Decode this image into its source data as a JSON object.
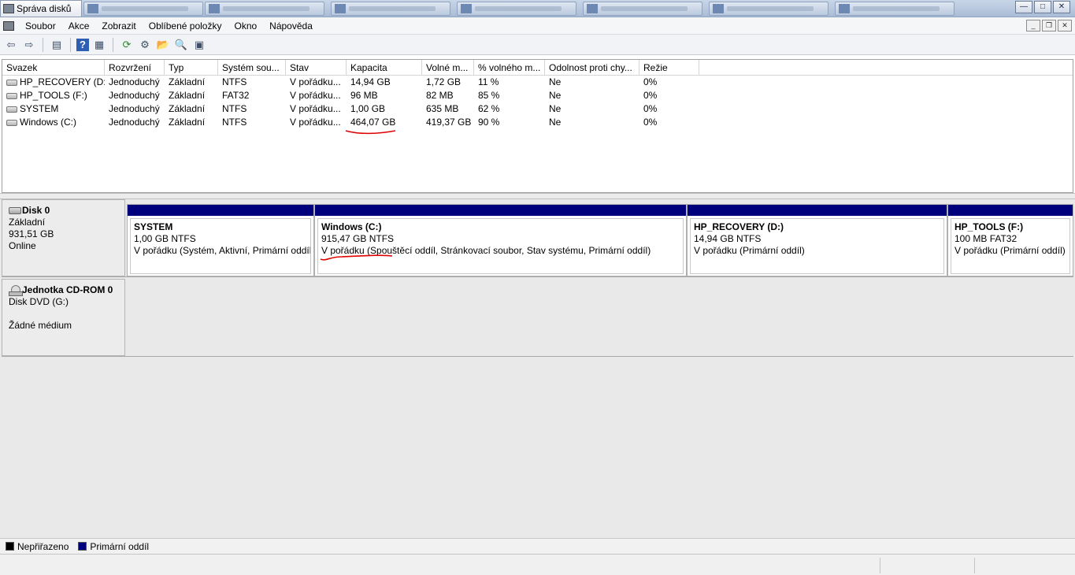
{
  "window": {
    "title": "Správa disků",
    "task_tabs": [
      "",
      "",
      "",
      "",
      "",
      "",
      "",
      "",
      ""
    ],
    "controls": {
      "minimize": "—",
      "maximize": "□",
      "close": "✕"
    }
  },
  "menu": {
    "items": [
      "Soubor",
      "Akce",
      "Zobrazit",
      "Oblíbené položky",
      "Okno",
      "Nápověda"
    ],
    "mdi_controls": {
      "minimize": "_",
      "restore": "❐",
      "close": "✕"
    }
  },
  "toolbar": {
    "icons": [
      "back-icon",
      "forward-icon",
      "console-tree-icon",
      "help-icon",
      "properties-icon",
      "refresh-icon",
      "settings-icon",
      "open-icon",
      "find-icon",
      "disk-properties-icon"
    ],
    "glyphs": {
      "back": "⇦",
      "forward": "⇨",
      "tree": "▤",
      "help": "?",
      "props": "▦",
      "refresh": "⟳",
      "settings": "⚙",
      "open": "📂",
      "find": "🔍",
      "disk": "▣"
    }
  },
  "volume_table": {
    "columns": [
      "Svazek",
      "Rozvržení",
      "Typ",
      "Systém sou...",
      "Stav",
      "Kapacita",
      "Volné m...",
      "% volného m...",
      "Odolnost proti chy...",
      "Režie"
    ],
    "rows": [
      [
        "HP_RECOVERY (D:)",
        "Jednoduchý",
        "Základní",
        "NTFS",
        "V pořádku...",
        "14,94 GB",
        "1,72 GB",
        "11 %",
        "Ne",
        "0%"
      ],
      [
        "HP_TOOLS (F:)",
        "Jednoduchý",
        "Základní",
        "FAT32",
        "V pořádku...",
        "96 MB",
        "82 MB",
        "85 %",
        "Ne",
        "0%"
      ],
      [
        "SYSTEM",
        "Jednoduchý",
        "Základní",
        "NTFS",
        "V pořádku...",
        "1,00 GB",
        "635 MB",
        "62 %",
        "Ne",
        "0%"
      ],
      [
        "Windows (C:)",
        "Jednoduchý",
        "Základní",
        "NTFS",
        "V pořádku...",
        "464,07 GB",
        "419,37 GB",
        "90 %",
        "Ne",
        "0%"
      ]
    ]
  },
  "disks": [
    {
      "name": "Disk 0",
      "type": "Základní",
      "size": "931,51 GB",
      "status": "Online",
      "partitions": [
        {
          "name": "SYSTEM",
          "size": "1,00 GB NTFS",
          "status": "V pořádku (Systém, Aktivní, Primární oddíl"
        },
        {
          "name": "Windows  (C:)",
          "size": "915,47 GB NTFS",
          "status": "V pořádku (Spouštěcí oddíl, Stránkovací soubor, Stav systému, Primární oddíl)"
        },
        {
          "name": "HP_RECOVERY  (D:)",
          "size": "14,94 GB NTFS",
          "status": "V pořádku (Primární oddíl)"
        },
        {
          "name": "HP_TOOLS  (F:)",
          "size": "100 MB FAT32",
          "status": "V pořádku (Primární oddíl)"
        }
      ]
    },
    {
      "name": "Jednotka CD-ROM 0",
      "type": "Disk DVD (G:)",
      "size": "",
      "status": "Žádné médium"
    }
  ],
  "legend": [
    {
      "label": "Nepřiřazeno",
      "color": "#000000"
    },
    {
      "label": "Primární oddíl",
      "color": "#00007d"
    }
  ],
  "colors": {
    "primary_partition": "#00007d",
    "annotation": "#e00000"
  }
}
